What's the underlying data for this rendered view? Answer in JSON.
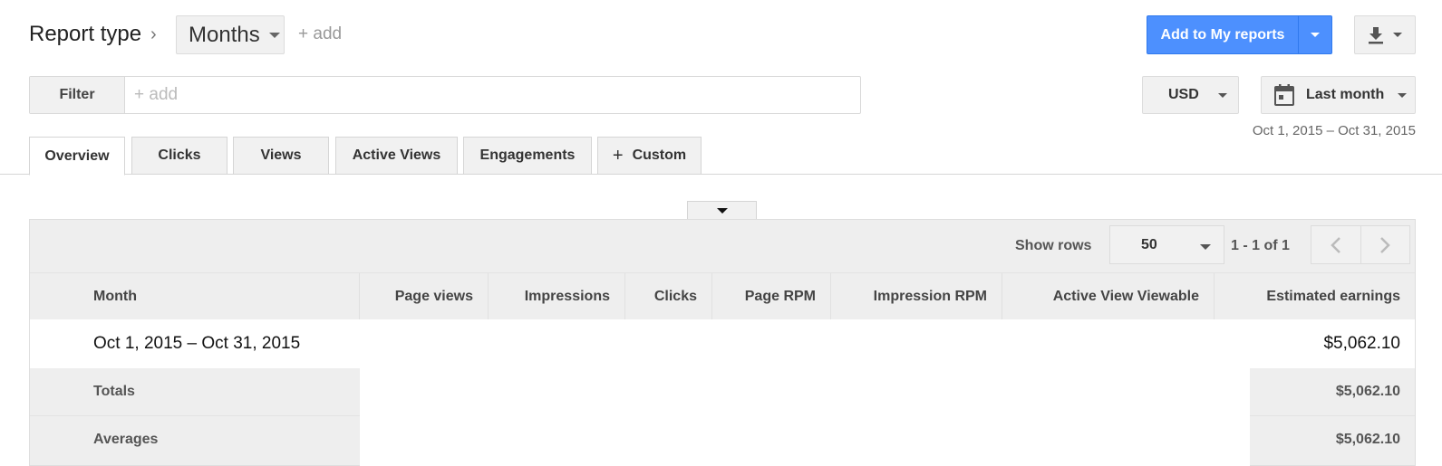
{
  "header": {
    "report_type_label": "Report type",
    "breadcrumb_sep": "›",
    "dimension": "Months",
    "add_dimension": "+ add",
    "add_to_reports": "Add to My reports"
  },
  "filter": {
    "label": "Filter",
    "placeholder": "+ add"
  },
  "currency": "USD",
  "date": {
    "preset": "Last month",
    "range": "Oct 1, 2015 – Oct 31, 2015"
  },
  "tabs": [
    {
      "label": "Overview",
      "active": true
    },
    {
      "label": "Clicks"
    },
    {
      "label": "Views"
    },
    {
      "label": "Active Views"
    },
    {
      "label": "Engagements"
    },
    {
      "label": "Custom",
      "icon": "+"
    }
  ],
  "table": {
    "show_rows_label": "Show rows",
    "rows_value": "50",
    "pager_text": "1 - 1 of 1",
    "columns": [
      "Month",
      "Page views",
      "Impressions",
      "Clicks",
      "Page RPM",
      "Impression RPM",
      "Active View Viewable",
      "Estimated earnings"
    ],
    "rows": [
      {
        "month": "Oct 1, 2015 – Oct 31, 2015",
        "estimated_earnings": "$5,062.10"
      }
    ],
    "totals": {
      "label": "Totals",
      "estimated_earnings": "$5,062.10"
    },
    "averages": {
      "label": "Averages",
      "estimated_earnings": "$5,062.10"
    }
  },
  "colors": {
    "accent": "#4d90fe",
    "panel_bg": "#eeeeee"
  }
}
